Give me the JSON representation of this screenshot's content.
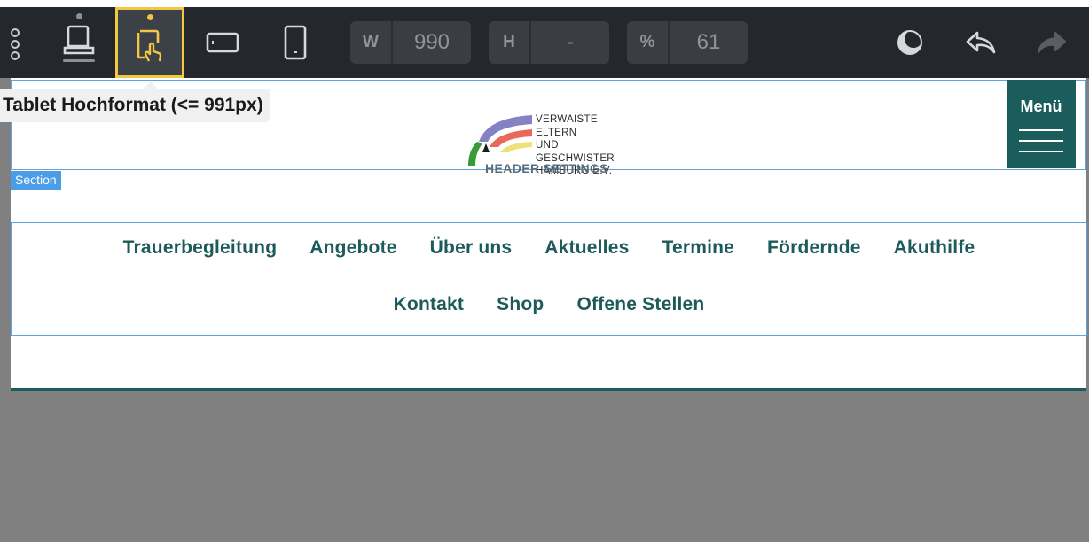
{
  "toolbar": {
    "device_modes": [
      {
        "icon": "laptop-icon"
      },
      {
        "icon": "tablet-portrait-touch-icon",
        "active": true
      },
      {
        "icon": "tablet-landscape-icon"
      },
      {
        "icon": "mobile-portrait-icon"
      }
    ],
    "width": {
      "key": "W",
      "value": "990"
    },
    "height": {
      "key": "H",
      "value": "-"
    },
    "zoom": {
      "key": "%",
      "value": "61"
    },
    "accent_color": "#f2c744"
  },
  "tooltip": {
    "text": "Tablet Hochformat (<= 991px)"
  },
  "header": {
    "logo_lines": [
      "VERWAISTE ELTERN",
      "UND GESCHWISTER",
      "HAMBURG E.V."
    ],
    "settings_label": "HEADER SETTINGS",
    "menu_label": "Menü",
    "brand_color": "#1b5c5c"
  },
  "section_tag": "Section",
  "nav": {
    "row1": [
      "Trauerbegleitung",
      "Angebote",
      "Über uns",
      "Aktuelles",
      "Termine",
      "Fördernde",
      "Akuthilfe"
    ],
    "row2": [
      "Kontakt",
      "Shop",
      "Offene Stellen"
    ]
  }
}
